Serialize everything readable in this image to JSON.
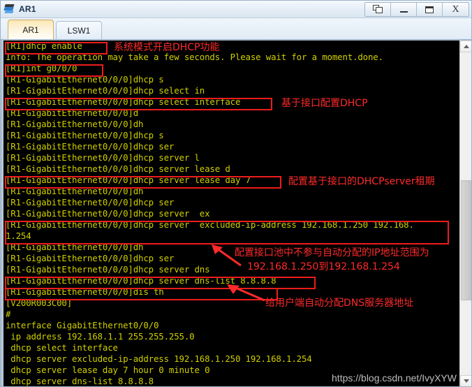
{
  "window": {
    "title": "AR1",
    "icon": "ar-router-icon",
    "buttons": [
      {
        "name": "cascade-button",
        "label": ""
      },
      {
        "name": "minimize-button",
        "label": ""
      },
      {
        "name": "maximize-button",
        "label": ""
      },
      {
        "name": "close-button",
        "label": "X"
      }
    ]
  },
  "tabs": [
    {
      "label": "AR1",
      "active": true
    },
    {
      "label": "LSW1",
      "active": false
    }
  ],
  "terminal": {
    "fg_color": "#cfcf00",
    "bg_color": "#000000",
    "annotation_color": "#ff2a2a",
    "lines": [
      "[R1]dhcp enable",
      "Info: The operation may take a few seconds. Please wait for a moment.done.",
      "[R1]int g0/0/0",
      "[R1-GigabitEthernet0/0/0]dhcp s",
      "[R1-GigabitEthernet0/0/0]dhcp select in",
      "[R1-GigabitEthernet0/0/0]dhcp select interface",
      "[R1-GigabitEthernet0/0/0]d",
      "[R1-GigabitEthernet0/0/0]dh",
      "[R1-GigabitEthernet0/0/0]dhcp s",
      "[R1-GigabitEthernet0/0/0]dhcp ser",
      "[R1-GigabitEthernet0/0/0]dhcp server l",
      "[R1-GigabitEthernet0/0/0]dhcp server lease d",
      "[R1-GigabitEthernet0/0/0]dhcp server lease day 7",
      "[R1-GigabitEthernet0/0/0]dh",
      "[R1-GigabitEthernet0/0/0]dhcp ser",
      "[R1-GigabitEthernet0/0/0]dhcp server  ex",
      "[R1-GigabitEthernet0/0/0]dhcp server  excluded-ip-address 192.168.1.250 192.168.",
      "1.254",
      "[R1-GigabitEthernet0/0/0]dh",
      "[R1-GigabitEthernet0/0/0]dhcp ser",
      "[R1-GigabitEthernet0/0/0]dhcp server dns",
      "[R1-GigabitEthernet0/0/0]dhcp server dns-list 8.8.8.8",
      "[R1-GigabitEthernet0/0/0]dis th",
      "[V200R003C00]",
      "#",
      "interface GigabitEthernet0/0/0",
      " ip address 192.168.1.1 255.255.255.0",
      " dhcp select interface",
      " dhcp server excluded-ip-address 192.168.1.250 192.168.1.254",
      " dhcp server lease day 7 hour 0 minute 0",
      " dhcp server dns-list 8.8.8.8"
    ],
    "annotations": [
      {
        "name": "annotation-dhcp-enable",
        "text": "系统模式开启DHCP功能"
      },
      {
        "name": "annotation-select-iface",
        "text": "基于接口配置DHCP"
      },
      {
        "name": "annotation-lease",
        "text": "配置基于接口的DHCPserver租期"
      },
      {
        "name": "annotation-excluded-1",
        "text": "配置接口池中不参与自动分配的IP地址范围为"
      },
      {
        "name": "annotation-excluded-2",
        "text": "192.168.1.250到192.168.1.254"
      },
      {
        "name": "annotation-dns-list",
        "text": "给用户端自动分配DNS服务器地址"
      }
    ],
    "watermark": "https://blog.csdn.net/IvyXYW"
  },
  "scrollbar": {
    "up_arrow": "scroll-up-arrow",
    "down_arrow": "scroll-down-arrow"
  }
}
